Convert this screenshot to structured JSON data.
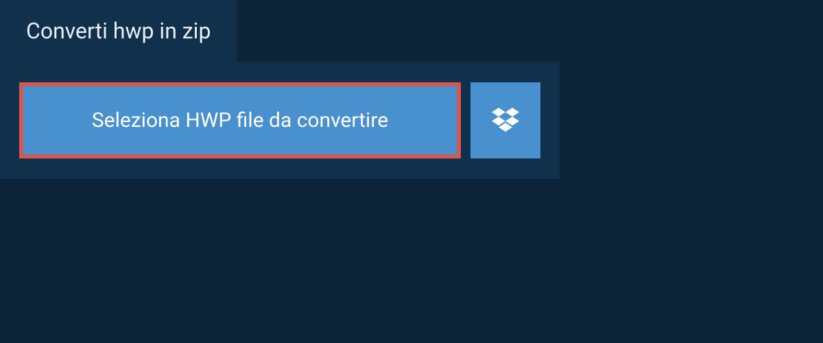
{
  "tab": {
    "title": "Converti hwp in zip"
  },
  "buttons": {
    "select_file": "Seleziona HWP file da convertire"
  }
}
